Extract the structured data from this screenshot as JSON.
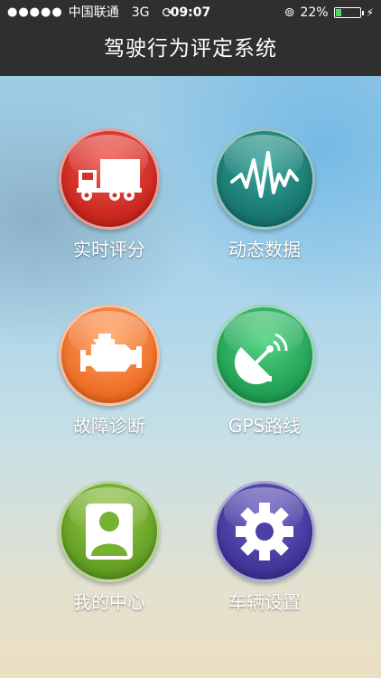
{
  "status_bar": {
    "signal_dots": "●●●●●",
    "carrier": "中国联通",
    "network": "3G",
    "time": "09:07",
    "battery_percent": "22%",
    "battery_level": 0.22
  },
  "header": {
    "title": "驾驶行为评定系统"
  },
  "menu": {
    "items": [
      {
        "label": "实时评分",
        "icon": "truck-icon",
        "color": "#d9342b"
      },
      {
        "label": "动态数据",
        "icon": "waveform-icon",
        "color": "#1e877e"
      },
      {
        "label": "故障诊断",
        "icon": "engine-icon",
        "color": "#f27c33"
      },
      {
        "label": "GPS路线",
        "icon": "satellite-dish-icon",
        "color": "#2db563"
      },
      {
        "label": "我的中心",
        "icon": "user-icon",
        "color": "#76b12f"
      },
      {
        "label": "车辆设置",
        "icon": "gear-icon",
        "color": "#4a40a8"
      }
    ]
  }
}
